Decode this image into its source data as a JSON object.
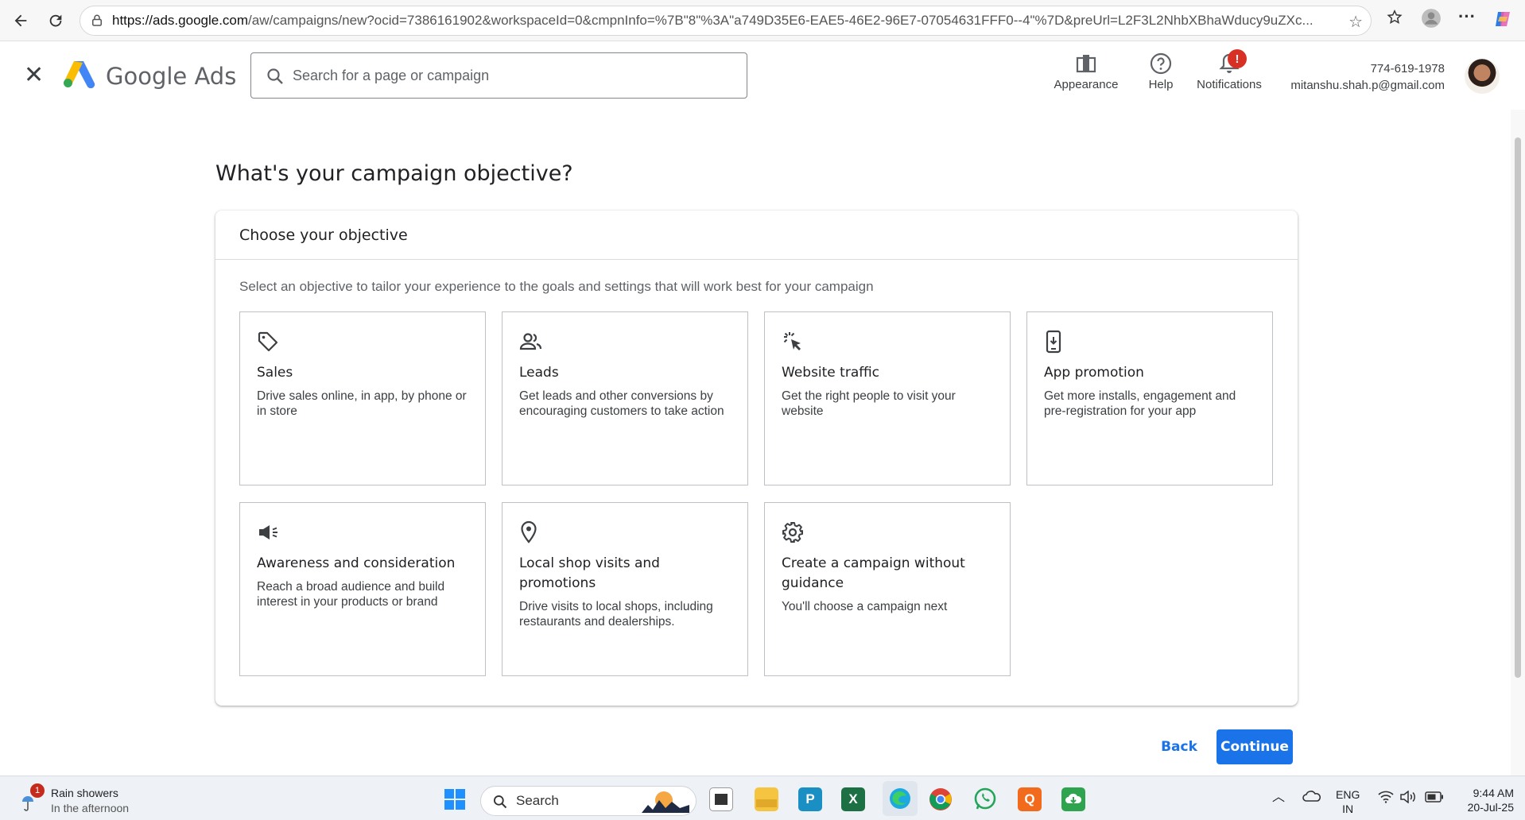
{
  "browser": {
    "url_host": "https://ads.google.com",
    "url_path": "/aw/campaigns/new?ocid=7386161902&workspaceId=0&cmpnInfo=%7B\"8\"%3A\"a749D35E6-EAE5-46E2-96E7-07054631FFF0--4\"%7D&preUrl=L2F3L2NhbXBhaWducy9uZXc...",
    "icons": [
      "back-arrow-icon",
      "reload-icon",
      "lock-icon",
      "star-icon",
      "favorites-icon",
      "profile-icon",
      "more-icon",
      "copilot-icon"
    ]
  },
  "header": {
    "brand": "Google Ads",
    "search_placeholder": "Search for a page or campaign",
    "appearance_label": "Appearance",
    "help_label": "Help",
    "notifications_label": "Notifications",
    "notifications_badge": "!",
    "account_phone": "774-619-1978",
    "account_email": "mitanshu.shah.p@gmail.com"
  },
  "page": {
    "title": "What's your campaign objective?",
    "card_title": "Choose your objective",
    "card_description": "Select an objective to tailor your experience to the goals and settings that will work best for your campaign"
  },
  "objectives": [
    {
      "icon": "tag-icon",
      "title": "Sales",
      "description": "Drive sales online, in app, by phone or in store"
    },
    {
      "icon": "people-icon",
      "title": "Leads",
      "description": "Get leads and other conversions by encouraging customers to take action"
    },
    {
      "icon": "click-icon",
      "title": "Website traffic",
      "description": "Get the right people to visit your website"
    },
    {
      "icon": "phone-download-icon",
      "title": "App promotion",
      "description": "Get more installs, engagement and pre-registration for your app"
    },
    {
      "icon": "megaphone-icon",
      "title": "Awareness and consideration",
      "description": "Reach a broad audience and build interest in your products or brand"
    },
    {
      "icon": "location-pin-icon",
      "title": "Local shop visits and promotions",
      "description": "Drive visits to local shops, including restaurants and dealerships."
    },
    {
      "icon": "gear-icon",
      "title": "Create a campaign without guidance",
      "description": "You'll choose a campaign next"
    }
  ],
  "actions": {
    "back_label": "Back",
    "continue_label": "Continue"
  },
  "taskbar": {
    "weather_badge": "1",
    "weather_title": "Rain showers",
    "weather_sub": "In the afternoon",
    "search_label": "Search",
    "lang_top": "ENG",
    "lang_bottom": "IN",
    "time": "9:44 AM",
    "date": "20-Jul-25"
  },
  "colors": {
    "accent": "#1a73e8",
    "badge_red": "#d93025"
  }
}
